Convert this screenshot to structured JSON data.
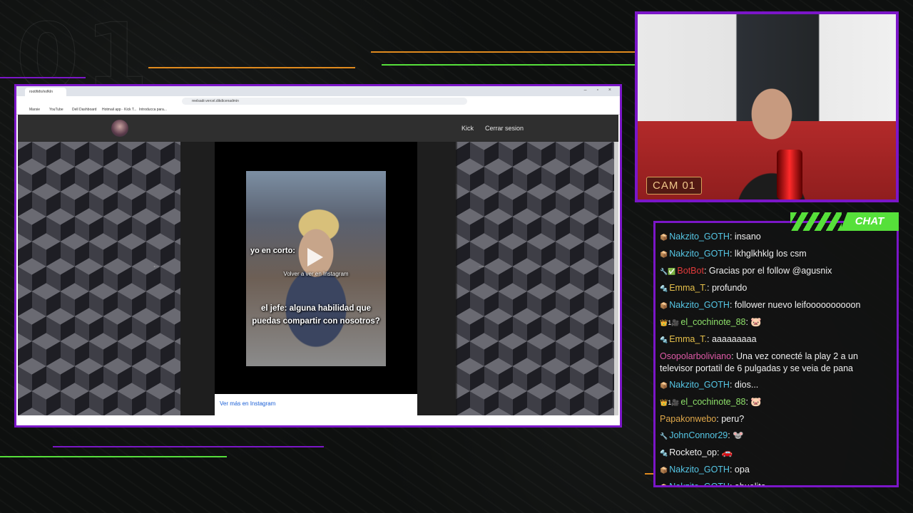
{
  "overlay": {
    "big_number": "01",
    "cam_label": "CAM 01",
    "chat_label": "CHAT",
    "colors": {
      "frame": "#7b16c8",
      "accent_green": "#56e03a",
      "accent_orange": "#e08a1e"
    }
  },
  "browser": {
    "tab_title": "root/tkfo/nofkIn",
    "address": "reelsadr.vercel.dikdicenadmin",
    "window_buttons": "– ▫ ×",
    "bookmarks": [
      "Marsie",
      "YouTube",
      "Dell Dashboard",
      "Hotmail app · Kick T...",
      "Introducca para..."
    ]
  },
  "site": {
    "nav_links": [
      "Kick",
      "Cerrar sesion"
    ],
    "prev_arrow": "←",
    "next_arrow": "→",
    "embed": {
      "caption_top": "yo en corto:",
      "rewatch": "Volver a ver en Instagram",
      "caption_bottom": "el jefe: alguna habilidad que puedas compartir con nosotros?",
      "footer_link": "Ver más en Instagram"
    }
  },
  "chat": {
    "messages": [
      {
        "icons": "📦",
        "user": "Nakzito_GOTH",
        "user_color": "#56c7e6",
        "text": "insano"
      },
      {
        "icons": "📦",
        "user": "Nakzito_GOTH",
        "user_color": "#56c7e6",
        "text": "lkhglkhklg los csm"
      },
      {
        "icons": "🔧✅",
        "user": "BotBot",
        "user_color": "#e03a3a",
        "text": "Gracias por el follow @agusnix"
      },
      {
        "icons": "🔩",
        "user": "Emma_T.",
        "user_color": "#e6c04a",
        "text": "profundo"
      },
      {
        "icons": "📦",
        "user": "Nakzito_GOTH",
        "user_color": "#56c7e6",
        "text": "follower nuevo leifoooooooooon"
      },
      {
        "icons": "👑1🎥",
        "user": "el_cochinote_88",
        "user_color": "#8ee06a",
        "text": "🐷"
      },
      {
        "icons": "🔩",
        "user": "Emma_T.",
        "user_color": "#e6c04a",
        "text": "aaaaaaaaa"
      },
      {
        "icons": "",
        "user": "Osopolarboliviano",
        "user_color": "#e05aa8",
        "text": "Una vez conecté la play 2 a un televisor portatil de 6 pulgadas y se veia de pana",
        "wrap": true
      },
      {
        "icons": "📦",
        "user": "Nakzito_GOTH",
        "user_color": "#56c7e6",
        "text": "dios..."
      },
      {
        "icons": "👑1🎥",
        "user": "el_cochinote_88",
        "user_color": "#8ee06a",
        "text": "🐷"
      },
      {
        "icons": "",
        "user": "Papakonwebo",
        "user_color": "#e0a84a",
        "text": "peru?"
      },
      {
        "icons": "🔧",
        "user": "JohnConnor29",
        "user_color": "#56c7e6",
        "text": "🐭"
      },
      {
        "icons": "🔩",
        "user": "Rocketo_op",
        "user_color": "#f0f0f0",
        "text": "🚗"
      },
      {
        "icons": "📦",
        "user": "Nakzito_GOTH",
        "user_color": "#56c7e6",
        "text": "opa"
      },
      {
        "icons": "📦",
        "user": "Nakzito_GOTH",
        "user_color": "#56c7e6",
        "text": "abuelita"
      }
    ]
  }
}
